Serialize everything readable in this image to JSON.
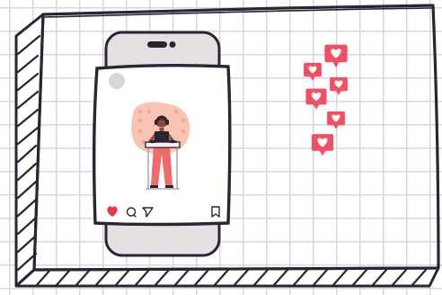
{
  "illustration": {
    "subject": "social-media-post",
    "colors": {
      "outline": "#2a2433",
      "grid": "#d8d4e4",
      "phone_body": "#e5e1e2",
      "phone_notch": "#2a2433",
      "card_bg": "#ffffff",
      "avatar": "#d9d6d8",
      "image_blob": "#f8c4b4",
      "heart_badge": "#f05062",
      "like_icon": "#e63946",
      "figure_skin": "#8a4a3a",
      "figure_top": "#2a2433",
      "figure_pants": "#ef6a6a",
      "dj_table": "#f2f2f2"
    },
    "post_actions": [
      "heart-icon",
      "comment-icon",
      "share-icon",
      "bookmark-icon"
    ],
    "floating_reactions_count": 6
  }
}
